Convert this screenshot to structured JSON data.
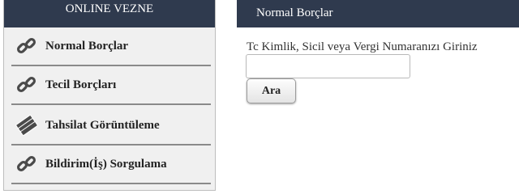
{
  "sidebar": {
    "title": "ONLINE VEZNE",
    "items": [
      {
        "label": "Normal Borçlar",
        "icon": "chain-link-icon"
      },
      {
        "label": "Tecil Borçları",
        "icon": "chain-link-icon"
      },
      {
        "label": "Tahsilat Görüntüleme",
        "icon": "banknotes-icon"
      },
      {
        "label": "Bildirim(İş) Sorgulama",
        "icon": "chain-link-icon"
      }
    ]
  },
  "main": {
    "title": "Normal Borçlar",
    "form": {
      "label": "Tc Kimlik, Sicil veya Vergi Numaranızı Giriniz",
      "input_value": "",
      "button_label": "Ara"
    }
  },
  "colors": {
    "header_bg": "#2f3a4e",
    "sidebar_bg": "#f0f0f0",
    "icon": "#4a4a4a"
  }
}
